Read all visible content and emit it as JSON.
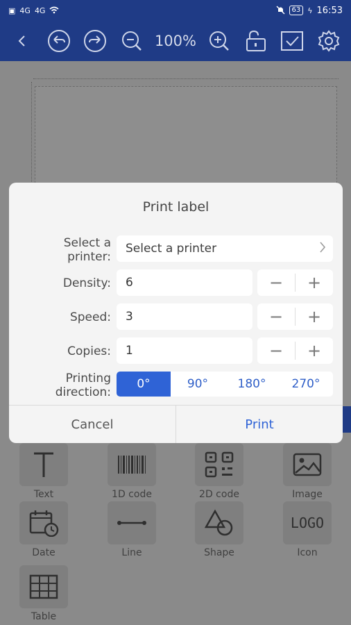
{
  "status": {
    "time": "16:53",
    "battery": "63",
    "signal1": "4G",
    "signal2": "4G"
  },
  "toolbar": {
    "zoom": "100%",
    "icons": [
      "back-icon",
      "undo-icon",
      "redo-icon",
      "zoom-out-icon",
      "zoom-in-icon",
      "lock-icon",
      "checkbox-icon",
      "settings-icon"
    ]
  },
  "tools": [
    {
      "label": "Text",
      "icon": "text-icon"
    },
    {
      "label": "1D code",
      "icon": "barcode-icon"
    },
    {
      "label": "2D code",
      "icon": "qrcode-icon"
    },
    {
      "label": "Image",
      "icon": "image-icon"
    },
    {
      "label": "Date",
      "icon": "date-icon"
    },
    {
      "label": "Line",
      "icon": "line-icon"
    },
    {
      "label": "Shape",
      "icon": "shape-icon"
    },
    {
      "label": "Icon",
      "icon": "logo-icon",
      "glyph": "LOGO"
    },
    {
      "label": "Table",
      "icon": "table-icon"
    }
  ],
  "dialog": {
    "title": "Print label",
    "printer_label_line1": "Select a",
    "printer_label_line2": "printer:",
    "printer_value": "Select a printer",
    "density_label": "Density:",
    "density_value": "6",
    "speed_label": "Speed:",
    "speed_value": "3",
    "copies_label": "Copies:",
    "copies_value": "1",
    "direction_label_line1": "Printing",
    "direction_label_line2": "direction:",
    "directions": [
      "0°",
      "90°",
      "180°",
      "270°"
    ],
    "selected_direction": "0°",
    "cancel": "Cancel",
    "print": "Print"
  }
}
